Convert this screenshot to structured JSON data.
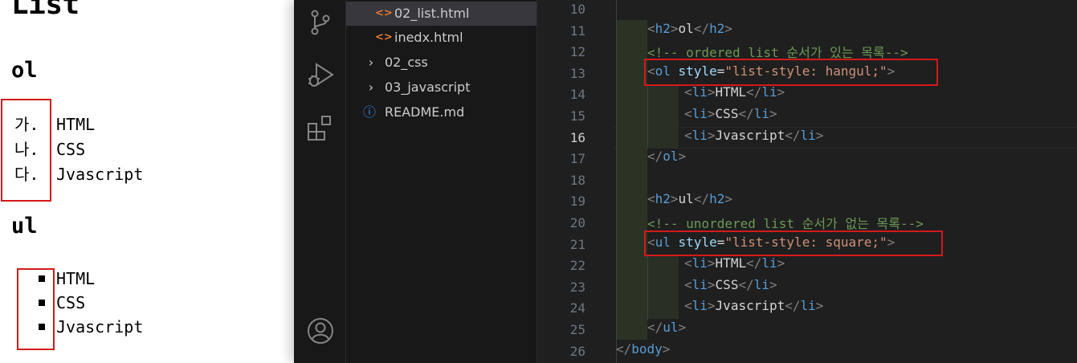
{
  "preview": {
    "title": "List",
    "ol_heading": "ol",
    "ul_heading": "ul",
    "ol_items": [
      {
        "marker": "가.",
        "text": "HTML"
      },
      {
        "marker": "나.",
        "text": "CSS"
      },
      {
        "marker": "다.",
        "text": "Jvascript"
      }
    ],
    "ul_items": [
      {
        "text": "HTML"
      },
      {
        "text": "CSS"
      },
      {
        "text": "Jvascript"
      }
    ]
  },
  "activity_bar": {
    "icons": [
      "source-control-icon",
      "run-debug-icon",
      "extensions-icon",
      "account-icon"
    ]
  },
  "explorer": {
    "items": [
      {
        "label": "02_list.html",
        "icon": "html-file-icon",
        "active": true
      },
      {
        "label": "inedx.html",
        "icon": "html-file-icon",
        "active": false
      },
      {
        "label": "02_css",
        "icon": "chevron-right-icon",
        "active": false
      },
      {
        "label": "03_javascript",
        "icon": "chevron-right-icon",
        "active": false
      },
      {
        "label": "README.md",
        "icon": "info-icon",
        "active": false
      }
    ]
  },
  "editor": {
    "current_line": 16,
    "line_numbers": [
      "10",
      "11",
      "12",
      "13",
      "14",
      "15",
      "16",
      "17",
      "18",
      "19",
      "20",
      "21",
      "22",
      "23",
      "24",
      "25",
      "26"
    ],
    "code": {
      "l11": {
        "open": "h2",
        "text": "ol",
        "close": "h2"
      },
      "l12": "<!-- ordered list 순서가 있는 목록-->",
      "l13": {
        "tag": "ol",
        "attr": "style",
        "eq": "=",
        "value": "\"list-style: hangul;\""
      },
      "l14": {
        "open": "li",
        "text": "HTML",
        "close": "li"
      },
      "l15": {
        "open": "li",
        "text": "CSS",
        "close": "li"
      },
      "l16": {
        "open": "li",
        "text": "Jvascript",
        "close": "li"
      },
      "l17": {
        "close": "ol"
      },
      "l19": {
        "open": "h2",
        "text": "ul",
        "close": "h2"
      },
      "l20": "<!-- unordered list 순서가 없는 목록-->",
      "l21": {
        "tag": "ul",
        "attr": "style",
        "eq": "=",
        "value": "\"list-style: square;\""
      },
      "l22": {
        "open": "li",
        "text": "HTML",
        "close": "li"
      },
      "l23": {
        "open": "li",
        "text": "CSS",
        "close": "li"
      },
      "l24": {
        "open": "li",
        "text": "Jvascript",
        "close": "li"
      },
      "l25": {
        "close": "ul"
      },
      "l26": {
        "close": "body"
      }
    }
  },
  "colors": {
    "highlight_box": "#d21a1a",
    "tag": "#569cd6",
    "attribute": "#9cdcfe",
    "string": "#ce9178",
    "comment": "#6a9955",
    "html_file_icon": "#e37933"
  }
}
